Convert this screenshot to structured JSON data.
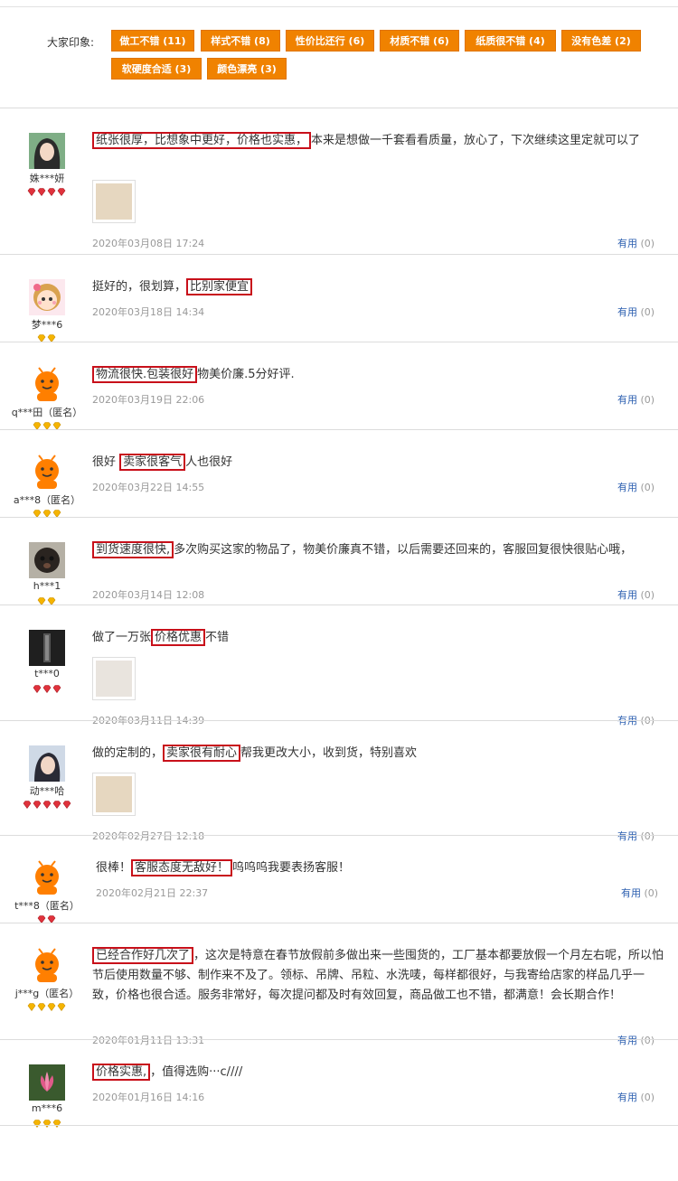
{
  "impressions": {
    "label": "大家印象:",
    "tags": [
      "做工不错 (11)",
      "样式不错 (8)",
      "性价比还行 (6)",
      "材质不错 (6)",
      "纸质很不错 (4)",
      "没有色差 (2)",
      "软硬度合适 (3)",
      "颜色漂亮 (3)"
    ]
  },
  "reviews": [
    {
      "user": "姝***妍",
      "level_icons": "red-gem",
      "level_count": 4,
      "highlight": "纸张很厚，比想象中更好，价格也实惠，",
      "text": "本来是想做一千套看看质量，放心了，下次继续这里定就可以了",
      "has_image": true,
      "date": "2020年03月08日 17:24",
      "useful_label": "有用",
      "useful_count": "(0)"
    },
    {
      "user": "梦***6",
      "level_icons": "gold-gem",
      "level_count": 2,
      "pre": "挺好的，很划算，",
      "highlight": "比别家便宜",
      "text": "",
      "has_image": false,
      "date": "2020年03月18日 14:34",
      "useful_label": "有用",
      "useful_count": "(0)"
    },
    {
      "user": "q***田（匿名）",
      "level_icons": "gold-gem",
      "level_count": 3,
      "highlight": "物流很快.包装很好",
      "text": "物美价廉.5分好评.",
      "has_image": false,
      "date": "2020年03月19日 22:06",
      "useful_label": "有用",
      "useful_count": "(0)"
    },
    {
      "user": "a***8（匿名）",
      "level_icons": "gold-gem",
      "level_count": 3,
      "pre": "很好 ",
      "highlight": "卖家很客气",
      "text": "人也很好",
      "has_image": false,
      "date": "2020年03月22日 14:55",
      "useful_label": "有用",
      "useful_count": "(0)"
    },
    {
      "user": "h***1",
      "level_icons": "gold-gem",
      "level_count": 2,
      "highlight": "到货速度很快,",
      "text": "多次购买这家的物品了，物美价廉真不错，以后需要还回来的，客服回复很快很贴心哦，",
      "has_image": false,
      "date": "2020年03月14日 12:08",
      "useful_label": "有用",
      "useful_count": "(0)"
    },
    {
      "user": "t***0",
      "level_icons": "red-gem",
      "level_count": 3,
      "pre": "做了一万张",
      "highlight": "价格优惠",
      "text": "不错",
      "has_image": true,
      "date": "2020年03月11日 14:39",
      "useful_label": "有用",
      "useful_count": "(0)"
    },
    {
      "user": "动***哈",
      "level_icons": "red-gem",
      "level_count": 5,
      "pre": "做的定制的，",
      "highlight": "卖家很有耐心",
      "text": "帮我更改大小，收到货，特别喜欢",
      "has_image": true,
      "date": "2020年02月27日 12:18",
      "useful_label": "有用",
      "useful_count": "(0)"
    },
    {
      "user": "t***8（匿名）",
      "level_icons": "red-gem",
      "level_count": 2,
      "pre": "很棒！",
      "highlight": "客服态度无敌好！",
      "text": "呜呜呜我要表扬客服！",
      "has_image": false,
      "date": "2020年02月21日 22:37",
      "useful_label": "有用",
      "useful_count": "(0)"
    },
    {
      "user": "j***g（匿名）",
      "level_icons": "gold-gem",
      "level_count": 4,
      "highlight": "已经合作好几次了",
      "text": "，这次是特意在春节放假前多做出来一些囤货的，工厂基本都要放假一个月左右呢，所以怕节后使用数量不够、制作来不及了。领标、吊牌、吊粒、水洗唛，每样都很好，与我寄给店家的样品几乎一致，价格也很合适。服务非常好，每次提问都及时有效回复，商品做工也不错，都满意！会长期合作！",
      "has_image": false,
      "date": "2020年01月11日 13:31",
      "useful_label": "有用",
      "useful_count": "(0)"
    },
    {
      "user": "m***6",
      "level_icons": "gold-gem",
      "level_count": 3,
      "highlight": "价格实惠,",
      "text": "，值得选购···c////",
      "has_image": false,
      "date": "2020年01月16日 14:16",
      "useful_label": "有用",
      "useful_count": "(0)"
    }
  ],
  "colors": {
    "tag_bg": "#f08200",
    "highlight_border": "#c8101a",
    "useful_link": "#2c5fb0"
  }
}
